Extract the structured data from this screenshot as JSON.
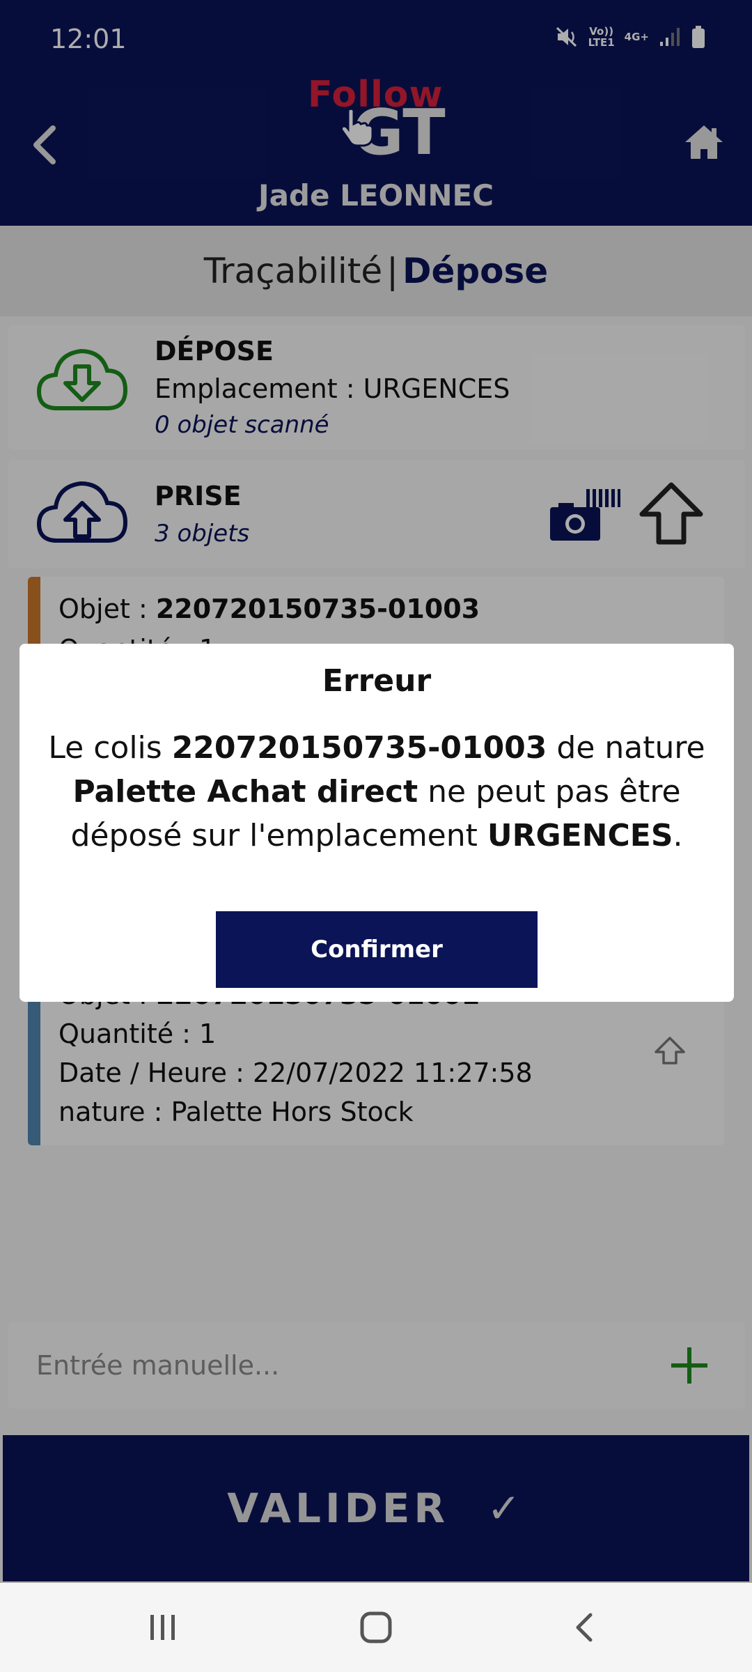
{
  "status_bar": {
    "time": "12:01",
    "volte": "Vo))\nLTE1",
    "network": "4G+"
  },
  "header": {
    "logo_top": "Follow",
    "logo_bottom": "GT",
    "user_name": "Jade LEONNEC"
  },
  "page_title": {
    "part1": "Traçabilité",
    "separator": "|",
    "part2": "Dépose"
  },
  "depose_card": {
    "title": "DÉPOSE",
    "location": "Emplacement : URGENCES",
    "count": "0 objet scanné",
    "icon_color": "#1e8a1e"
  },
  "prise_card": {
    "title": "PRISE",
    "count": "3 objets"
  },
  "objects": [
    {
      "object": "Objet : ",
      "object_id": "220720150735-01003",
      "quantity": "Quantité : 1",
      "bar_color": "#c9772b"
    },
    {
      "object": "Objet : ",
      "object_id": "220720150735-01001",
      "quantity": "Quantité : 1",
      "datetime": "Date / Heure : 22/07/2022 11:27:58",
      "nature": "nature : Palette Hors Stock",
      "bar_color": "#4f86b0"
    }
  ],
  "manual_entry": {
    "placeholder": "Entrée manuelle..."
  },
  "validate_button": {
    "label": "VALIDER",
    "check": "✓"
  },
  "dialog": {
    "title": "Erreur",
    "msg_1": "Le colis ",
    "msg_colis": "220720150735-01003",
    "msg_2": " de nature ",
    "msg_nature": "Palette Achat direct",
    "msg_3": " ne peut pas être déposé sur l'emplacement ",
    "msg_location": "URGENCES",
    "msg_4": ".",
    "confirm_label": "Confirmer"
  },
  "colors": {
    "primary": "#0b1457",
    "accent_red": "#d8213a",
    "success_green": "#1e8a1e"
  }
}
